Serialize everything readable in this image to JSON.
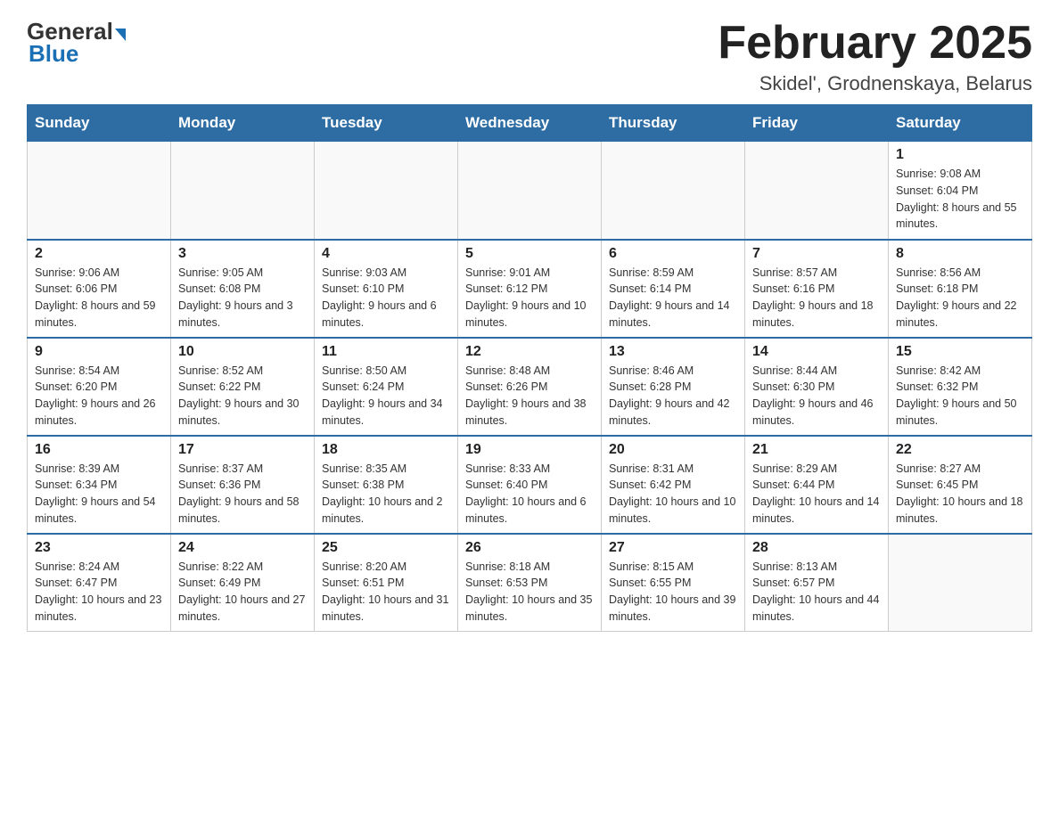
{
  "logo": {
    "general": "General",
    "blue": "Blue"
  },
  "title": "February 2025",
  "location": "Skidel', Grodnenskaya, Belarus",
  "days_of_week": [
    "Sunday",
    "Monday",
    "Tuesday",
    "Wednesday",
    "Thursday",
    "Friday",
    "Saturday"
  ],
  "weeks": [
    [
      {
        "day": "",
        "info": ""
      },
      {
        "day": "",
        "info": ""
      },
      {
        "day": "",
        "info": ""
      },
      {
        "day": "",
        "info": ""
      },
      {
        "day": "",
        "info": ""
      },
      {
        "day": "",
        "info": ""
      },
      {
        "day": "1",
        "info": "Sunrise: 9:08 AM\nSunset: 6:04 PM\nDaylight: 8 hours and 55 minutes."
      }
    ],
    [
      {
        "day": "2",
        "info": "Sunrise: 9:06 AM\nSunset: 6:06 PM\nDaylight: 8 hours and 59 minutes."
      },
      {
        "day": "3",
        "info": "Sunrise: 9:05 AM\nSunset: 6:08 PM\nDaylight: 9 hours and 3 minutes."
      },
      {
        "day": "4",
        "info": "Sunrise: 9:03 AM\nSunset: 6:10 PM\nDaylight: 9 hours and 6 minutes."
      },
      {
        "day": "5",
        "info": "Sunrise: 9:01 AM\nSunset: 6:12 PM\nDaylight: 9 hours and 10 minutes."
      },
      {
        "day": "6",
        "info": "Sunrise: 8:59 AM\nSunset: 6:14 PM\nDaylight: 9 hours and 14 minutes."
      },
      {
        "day": "7",
        "info": "Sunrise: 8:57 AM\nSunset: 6:16 PM\nDaylight: 9 hours and 18 minutes."
      },
      {
        "day": "8",
        "info": "Sunrise: 8:56 AM\nSunset: 6:18 PM\nDaylight: 9 hours and 22 minutes."
      }
    ],
    [
      {
        "day": "9",
        "info": "Sunrise: 8:54 AM\nSunset: 6:20 PM\nDaylight: 9 hours and 26 minutes."
      },
      {
        "day": "10",
        "info": "Sunrise: 8:52 AM\nSunset: 6:22 PM\nDaylight: 9 hours and 30 minutes."
      },
      {
        "day": "11",
        "info": "Sunrise: 8:50 AM\nSunset: 6:24 PM\nDaylight: 9 hours and 34 minutes."
      },
      {
        "day": "12",
        "info": "Sunrise: 8:48 AM\nSunset: 6:26 PM\nDaylight: 9 hours and 38 minutes."
      },
      {
        "day": "13",
        "info": "Sunrise: 8:46 AM\nSunset: 6:28 PM\nDaylight: 9 hours and 42 minutes."
      },
      {
        "day": "14",
        "info": "Sunrise: 8:44 AM\nSunset: 6:30 PM\nDaylight: 9 hours and 46 minutes."
      },
      {
        "day": "15",
        "info": "Sunrise: 8:42 AM\nSunset: 6:32 PM\nDaylight: 9 hours and 50 minutes."
      }
    ],
    [
      {
        "day": "16",
        "info": "Sunrise: 8:39 AM\nSunset: 6:34 PM\nDaylight: 9 hours and 54 minutes."
      },
      {
        "day": "17",
        "info": "Sunrise: 8:37 AM\nSunset: 6:36 PM\nDaylight: 9 hours and 58 minutes."
      },
      {
        "day": "18",
        "info": "Sunrise: 8:35 AM\nSunset: 6:38 PM\nDaylight: 10 hours and 2 minutes."
      },
      {
        "day": "19",
        "info": "Sunrise: 8:33 AM\nSunset: 6:40 PM\nDaylight: 10 hours and 6 minutes."
      },
      {
        "day": "20",
        "info": "Sunrise: 8:31 AM\nSunset: 6:42 PM\nDaylight: 10 hours and 10 minutes."
      },
      {
        "day": "21",
        "info": "Sunrise: 8:29 AM\nSunset: 6:44 PM\nDaylight: 10 hours and 14 minutes."
      },
      {
        "day": "22",
        "info": "Sunrise: 8:27 AM\nSunset: 6:45 PM\nDaylight: 10 hours and 18 minutes."
      }
    ],
    [
      {
        "day": "23",
        "info": "Sunrise: 8:24 AM\nSunset: 6:47 PM\nDaylight: 10 hours and 23 minutes."
      },
      {
        "day": "24",
        "info": "Sunrise: 8:22 AM\nSunset: 6:49 PM\nDaylight: 10 hours and 27 minutes."
      },
      {
        "day": "25",
        "info": "Sunrise: 8:20 AM\nSunset: 6:51 PM\nDaylight: 10 hours and 31 minutes."
      },
      {
        "day": "26",
        "info": "Sunrise: 8:18 AM\nSunset: 6:53 PM\nDaylight: 10 hours and 35 minutes."
      },
      {
        "day": "27",
        "info": "Sunrise: 8:15 AM\nSunset: 6:55 PM\nDaylight: 10 hours and 39 minutes."
      },
      {
        "day": "28",
        "info": "Sunrise: 8:13 AM\nSunset: 6:57 PM\nDaylight: 10 hours and 44 minutes."
      },
      {
        "day": "",
        "info": ""
      }
    ]
  ]
}
